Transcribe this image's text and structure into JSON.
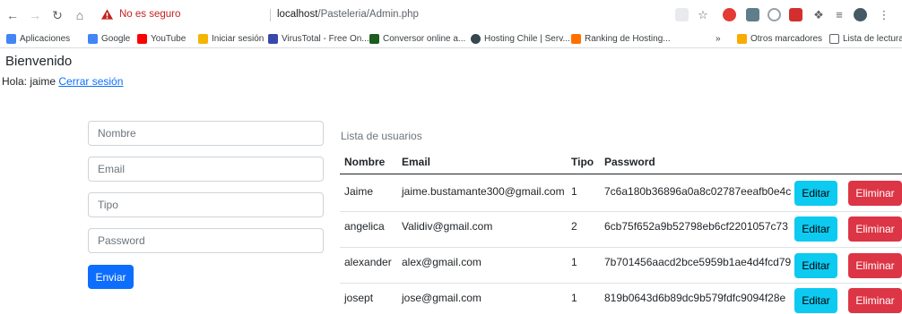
{
  "browser": {
    "security_label": "No es seguro",
    "url_host": "localhost",
    "url_path": "/Pasteleria/Admin.php",
    "extension_icons": [
      "translate-icon",
      "star-icon",
      "abp-icon",
      "extension-icon",
      "opera-icon",
      "pdf-icon",
      "puzzle-icon",
      "playlist-icon",
      "profile-icon",
      "menu-icon"
    ]
  },
  "bookmarks": {
    "items": [
      {
        "label": "Aplicaciones",
        "color": "#4285f4"
      },
      {
        "label": "Google",
        "color": "#4285f4"
      },
      {
        "label": "YouTube",
        "color": "#ff0000"
      },
      {
        "label": "Iniciar sesión",
        "color": "#f4b400"
      },
      {
        "label": "VirusTotal - Free On...",
        "color": "#3949ab"
      },
      {
        "label": "Conversor online a...",
        "color": "#1b5e20"
      },
      {
        "label": "Hosting Chile | Serv...",
        "color": "#37474f"
      },
      {
        "label": "Ranking de Hosting...",
        "color": "#ff6f00"
      }
    ],
    "overflow": "»",
    "other": "Otros marcadores",
    "reading_list": "Lista de lectura"
  },
  "page": {
    "title": "Bienvenido",
    "greeting": "Hola: jaime",
    "logout_link": "Cerrar sesión"
  },
  "form": {
    "name_placeholder": "Nombre",
    "email_placeholder": "Email",
    "type_placeholder": "Tipo",
    "password_placeholder": "Password",
    "submit_label": "Enviar"
  },
  "users": {
    "title": "Lista de usuarios",
    "columns": [
      "Nombre",
      "Email",
      "Tipo",
      "Password"
    ],
    "edit_label": "Editar",
    "delete_label": "Eliminar",
    "rows": [
      {
        "nombre": "Jaime",
        "email": "jaime.bustamante300@gmail.com",
        "tipo": "1",
        "password": "7c6a180b36896a0a8c02787eeafb0e4c"
      },
      {
        "nombre": "angelica",
        "email": "Validiv@gmail.com",
        "tipo": "2",
        "password": "6cb75f652a9b52798eb6cf2201057c73"
      },
      {
        "nombre": "alexander",
        "email": "alex@gmail.com",
        "tipo": "1",
        "password": "7b701456aacd2bce5959b1ae4d4fcd79"
      },
      {
        "nombre": "josept",
        "email": "jose@gmail.com",
        "tipo": "1",
        "password": "819b0643d6b89dc9b579fdfc9094f28e"
      }
    ]
  },
  "colors": {
    "primary": "#0d6efd",
    "info": "#0dcaf0",
    "danger": "#dc3545",
    "insecure": "#c5221f"
  }
}
